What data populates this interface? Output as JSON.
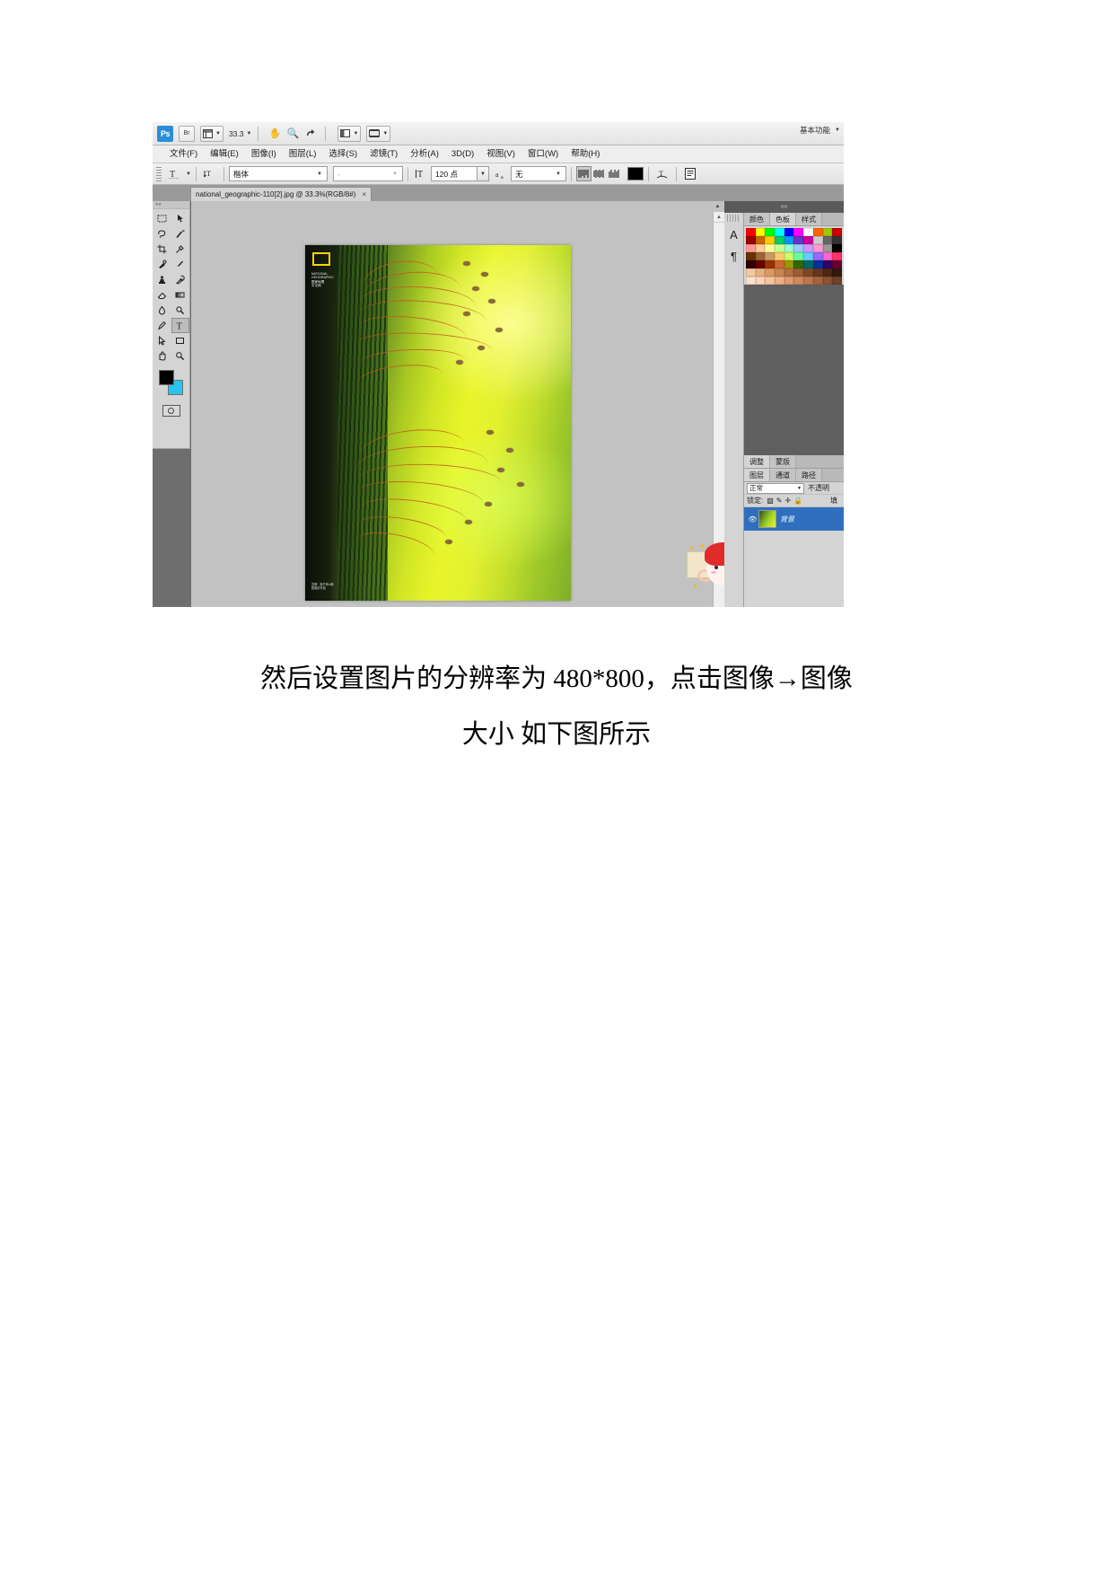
{
  "app": {
    "logo": "Ps",
    "bridge_button": "Br",
    "zoom_level": "33.3",
    "workspace_label": "基本功能"
  },
  "menubar": {
    "items": [
      "文件(F)",
      "编辑(E)",
      "图像(I)",
      "图层(L)",
      "选择(S)",
      "滤镜(T)",
      "分析(A)",
      "3D(D)",
      "视图(V)",
      "窗口(W)",
      "帮助(H)"
    ]
  },
  "options_bar": {
    "font_family": "楷体",
    "font_style": "-",
    "font_size": "120 点",
    "anti_alias": "无",
    "align_buttons": [
      "align-left",
      "align-center",
      "align-right"
    ],
    "color_swatch": "#000000",
    "warp_icon": "warp-text-icon",
    "panels_icon": "toggle-panels-icon"
  },
  "document": {
    "tab_title": "national_geographic-110[2].jpg @ 33.3%(RGB/8#)",
    "close_label": "×"
  },
  "toolbox": {
    "tools": [
      "marquee-tool",
      "move-tool",
      "lasso-tool",
      "magic-wand-tool",
      "crop-tool",
      "eyedropper-tool",
      "healing-brush-tool",
      "brush-tool",
      "clone-stamp-tool",
      "history-brush-tool",
      "eraser-tool",
      "gradient-tool",
      "blur-tool",
      "dodge-tool",
      "pen-tool",
      "type-tool",
      "path-selection-tool",
      "shape-tool",
      "hand-tool",
      "zoom-tool"
    ],
    "foreground_color": "#000000",
    "background_color": "#29c3ef",
    "quick_mask": "quick-mask-icon"
  },
  "color_panels": {
    "tabs": [
      "颜色",
      "色板",
      "样式"
    ],
    "active_tab": "色板",
    "swatch_colors": [
      "#ff0000",
      "#ffff00",
      "#00ff00",
      "#00ffff",
      "#0000ff",
      "#ff00ff",
      "#ffffff",
      "#ff6600",
      "#99cc00",
      "#cc0000",
      "#990000",
      "#cc6600",
      "#ffcc00",
      "#00cc66",
      "#0099ff",
      "#6633cc",
      "#cc0099",
      "#cccccc",
      "#666666",
      "#333333",
      "#ff9999",
      "#ffcc99",
      "#ffff99",
      "#ccff99",
      "#99ffcc",
      "#99ccff",
      "#cc99ff",
      "#ff99cc",
      "#999999",
      "#000000",
      "#663300",
      "#996633",
      "#cc9966",
      "#ffcc66",
      "#ccff66",
      "#66ff99",
      "#66ccff",
      "#9966ff",
      "#ff66cc",
      "#ff3366",
      "#330000",
      "#660000",
      "#993300",
      "#cc6633",
      "#999900",
      "#336600",
      "#006666",
      "#003399",
      "#330066",
      "#660033",
      "#f2c9a0",
      "#e8b27e",
      "#d99a63",
      "#c88550",
      "#b37040",
      "#9c5c34",
      "#7f4828",
      "#66361f",
      "#4d2617",
      "#331810",
      "#ffe0cc",
      "#ffd4b8",
      "#f7c2a0",
      "#eeae88",
      "#e09a70",
      "#d18a5e",
      "#bd764d",
      "#a5633f",
      "#8a5133",
      "#6e4029"
    ]
  },
  "text_panel": {
    "strip_icons": [
      "character-panel-icon",
      "paragraph-panel-icon"
    ],
    "character_icon": "A",
    "paragraph_icon": "¶"
  },
  "adjust_panels": {
    "tabs": [
      "调整",
      "蒙版"
    ],
    "active_tab": "调整"
  },
  "layers_panel": {
    "tabs": [
      "图层",
      "通道",
      "路径"
    ],
    "active_tab": "图层",
    "blend_mode": "正常",
    "opacity_label": "不透明",
    "lock_label": "锁定:",
    "lock_icons": [
      "lock-transparency-icon",
      "lock-image-icon",
      "lock-position-icon",
      "lock-all-icon"
    ],
    "fill_label": "填",
    "layers": [
      {
        "name": "背景",
        "visible": true,
        "thumbnail": "layer-thumb-photo"
      }
    ]
  },
  "canvas": {
    "artboard_label": "national-geographic-photo",
    "photo_title_lines": [
      "NATIONAL",
      "GEOGRAPHIC",
      "国家地理",
      "中文网"
    ],
    "photo_caption": "苔藓 · 孢子体\\n微距摄影作品",
    "mascot": "cartoon-sticker"
  },
  "caption": {
    "line1": "然后设置图片的分辨率为 480*800，点击图像→图像",
    "line2": "大小  如下图所示"
  }
}
